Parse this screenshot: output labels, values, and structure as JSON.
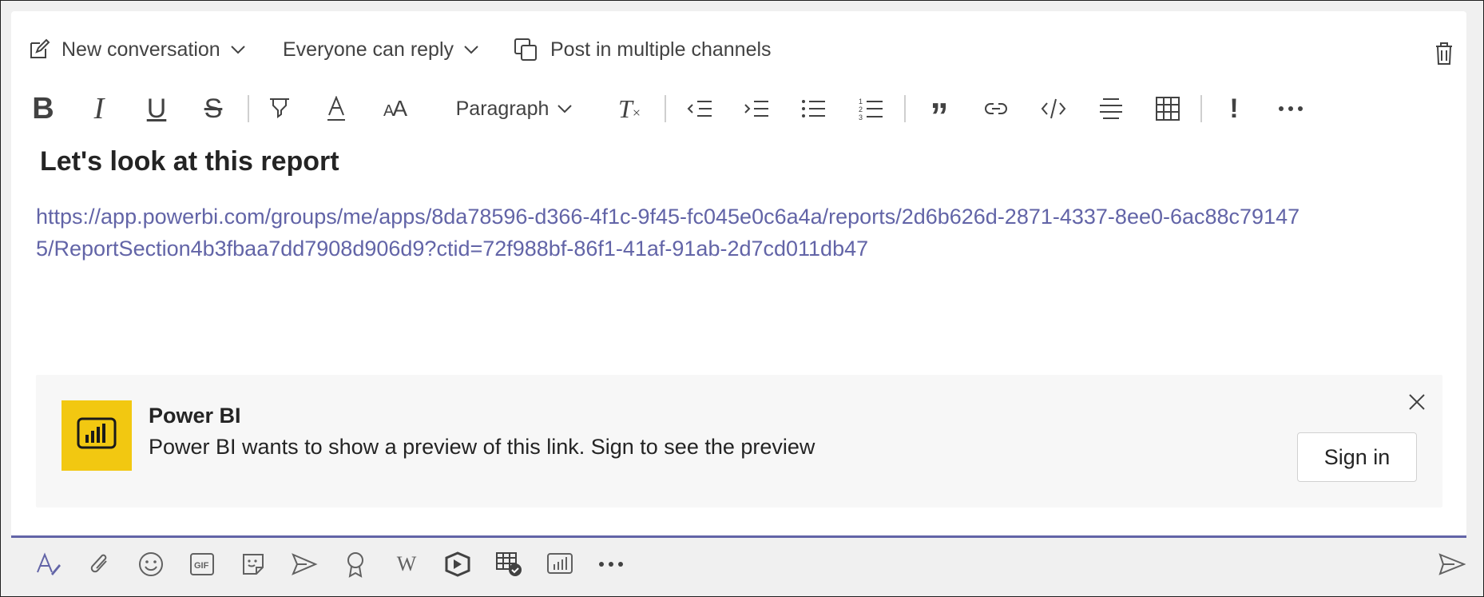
{
  "options": {
    "new_conversation": "New conversation",
    "reply_setting": "Everyone can reply",
    "post_multiple": "Post in multiple channels"
  },
  "toolbar": {
    "paragraph": "Paragraph"
  },
  "message": {
    "heading": "Let's look at this report",
    "link": "https://app.powerbi.com/groups/me/apps/8da78596-d366-4f1c-9f45-fc045e0c6a4a/reports/2d6b626d-2871-4337-8ee0-6ac88c791475/ReportSection4b3fbaa7dd7908d906d9?ctid=72f988bf-86f1-41af-91ab-2d7cd011db47"
  },
  "card": {
    "title": "Power BI",
    "description": "Power BI wants to show a preview of this link. Sign to see the preview",
    "sign_in": "Sign in",
    "logo_color": "#f2c811"
  },
  "colors": {
    "accent": "#6264a7",
    "link": "#6264a7"
  },
  "bottom_icons": [
    "format-icon",
    "attach-icon",
    "emoji-icon",
    "gif-icon",
    "sticker-icon",
    "schedule-meeting-icon",
    "praise-icon",
    "wiki-icon",
    "stream-icon",
    "approvals-icon",
    "power-bi-icon",
    "more-icon"
  ]
}
